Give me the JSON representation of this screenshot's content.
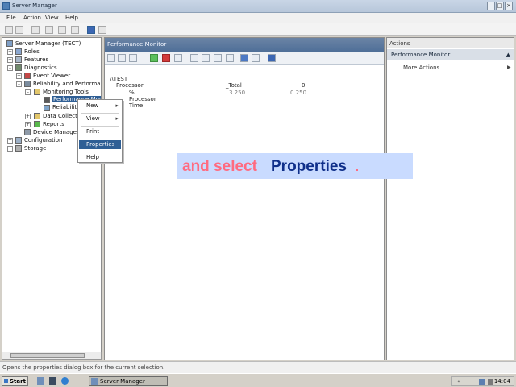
{
  "window": {
    "title": "Server Manager",
    "controls": {
      "minimize": "–",
      "maximize": "□",
      "close": "×"
    }
  },
  "menubar": {
    "file": "File",
    "action": "Action",
    "view": "View",
    "help": "Help"
  },
  "tree": {
    "root": "Server Manager (TECT)",
    "roles": "Roles",
    "features": "Features",
    "diagnostics": "Diagnostics",
    "event_viewer": "Event Viewer",
    "reliability": "Reliability and Performance",
    "monitoring_tools": "Monitoring Tools",
    "performance_monitor": "Performance Monit",
    "reliability_monitor": "Reliability",
    "data_collector": "Data Collector",
    "reports": "Reports",
    "device_manager": "Device Manager",
    "configuration": "Configuration",
    "storage": "Storage"
  },
  "perf_pane": {
    "header": "Performance Monitor",
    "report": {
      "machine": "\\\\TEST",
      "object": "Processor",
      "instance": "_Total",
      "instance_id": "0",
      "counter": "% Processor Time",
      "value_1": "3.250",
      "value_2": "0.250"
    }
  },
  "actions_pane": {
    "header": "Actions",
    "section": "Performance Monitor",
    "more_actions": "More Actions"
  },
  "context_menu": {
    "new": "New",
    "view": "View",
    "print": "Print",
    "properties": "Properties",
    "help": "Help"
  },
  "caption": {
    "lead": "and select",
    "key": "Properties",
    "tail": "."
  },
  "status_bar": "Opens the properties dialog box for the current selection.",
  "taskbar": {
    "start": "Start",
    "task": "Server Manager",
    "clock": "14:04"
  },
  "colors": {
    "title_bar": "#b7c7da",
    "perf_header": "#4f6f98",
    "menu_highlight": "#2f5f95",
    "caption_bg": "#c9dbff",
    "caption_accent": "#ff6b80",
    "caption_key": "#0f2f8a"
  }
}
